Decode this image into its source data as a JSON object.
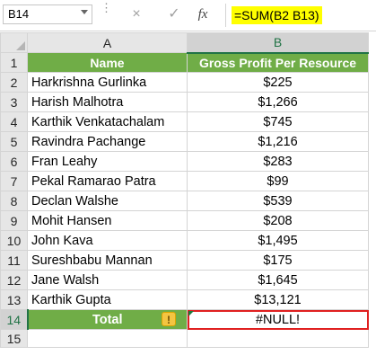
{
  "formula_bar": {
    "name_box": "B14",
    "cancel_icon": "×",
    "enter_icon": "✓",
    "fx_label": "fx",
    "formula": "=SUM(B2 B13)",
    "formula_highlight_color": "#ffff00"
  },
  "columns": [
    "A",
    "B"
  ],
  "rows": [
    {
      "num": "1",
      "a": "Name",
      "b": "Gross Profit Per Resource"
    },
    {
      "num": "2",
      "a": "Harkrishna Gurlinka",
      "b": "$225"
    },
    {
      "num": "3",
      "a": "Harish Malhotra",
      "b": "$1,266"
    },
    {
      "num": "4",
      "a": "Karthik Venkatachalam",
      "b": "$745"
    },
    {
      "num": "5",
      "a": "Ravindra Pachange",
      "b": "$1,216"
    },
    {
      "num": "6",
      "a": "Fran Leahy",
      "b": "$283"
    },
    {
      "num": "7",
      "a": "Pekal Ramarao Patra",
      "b": "$99"
    },
    {
      "num": "8",
      "a": "Declan Walshe",
      "b": "$539"
    },
    {
      "num": "9",
      "a": "Mohit Hansen",
      "b": "$208"
    },
    {
      "num": "10",
      "a": "John Kava",
      "b": "$1,495"
    },
    {
      "num": "11",
      "a": "Sureshbabu Mannan",
      "b": "$175"
    },
    {
      "num": "12",
      "a": "Jane Walsh",
      "b": "$1,645"
    },
    {
      "num": "13",
      "a": "Karthik Gupta",
      "b": "$13,121"
    },
    {
      "num": "14",
      "a": "Total",
      "b": "#NULL!"
    },
    {
      "num": "15",
      "a": "",
      "b": ""
    }
  ],
  "colors": {
    "header_green": "#70ad47",
    "error_outline": "#e02020",
    "excel_green": "#217346"
  },
  "icons": {
    "warning": "warning-icon",
    "error_indicator": "error-triangle-icon"
  }
}
